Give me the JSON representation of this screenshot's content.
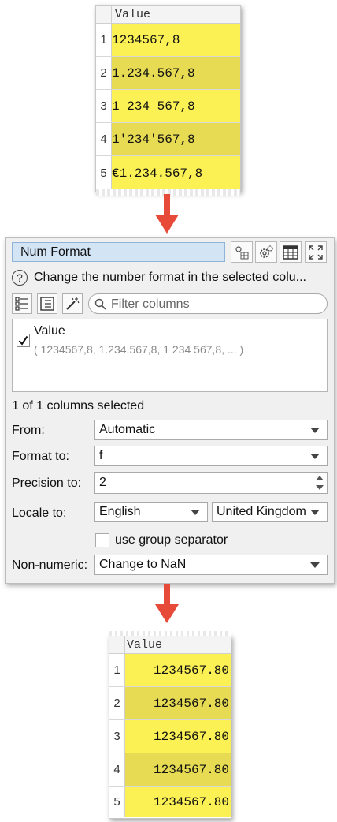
{
  "input_table": {
    "header": "Value",
    "rows": [
      {
        "index": "1",
        "value": "1234567,8"
      },
      {
        "index": "2",
        "value": "1.234.567,8"
      },
      {
        "index": "3",
        "value": "1 234 567,8"
      },
      {
        "index": "4",
        "value": "1'234'567,8"
      },
      {
        "index": "5",
        "value": "€1.234.567,8"
      }
    ]
  },
  "panel": {
    "title": "Num Format",
    "description": "Change the number format in the selected colu...",
    "filter_placeholder": "Filter columns",
    "column_name": "Value",
    "column_preview": "( 1234567,8, 1.234.567,8, 1 234 567,8, ... )",
    "selection_status": "1 of 1 columns selected",
    "from_label": "From:",
    "from_value": "Automatic",
    "format_label": "Format to:",
    "format_value": "f",
    "precision_label": "Precision to:",
    "precision_value": "2",
    "locale_label": "Locale to:",
    "locale_language": "English",
    "locale_country": "United Kingdom",
    "group_separator_label": "use group separator",
    "non_numeric_label": "Non-numeric:",
    "non_numeric_value": "Change to NaN"
  },
  "output_table": {
    "header": "Value",
    "rows": [
      {
        "index": "1",
        "value": "1234567.80"
      },
      {
        "index": "2",
        "value": "1234567.80"
      },
      {
        "index": "3",
        "value": "1234567.80"
      },
      {
        "index": "4",
        "value": "1234567.80"
      },
      {
        "index": "5",
        "value": "1234567.80"
      }
    ]
  },
  "colors": {
    "row_yellow_light": "#fbf155",
    "row_yellow_dark": "#e6db52",
    "arrow_red": "#e84a3a",
    "title_field_blue": "#d3e4f5"
  }
}
